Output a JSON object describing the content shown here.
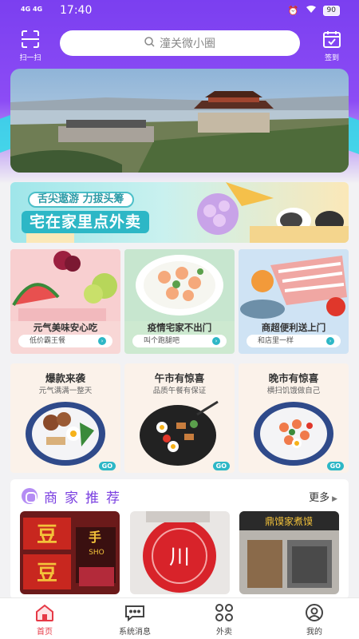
{
  "status_bar": {
    "network": [
      "4G",
      "4G"
    ],
    "time": "17:40",
    "battery": "90"
  },
  "header": {
    "scan_label": "扫一扫",
    "search_placeholder": "潼关微小圈",
    "checkin_label": "签到",
    "icons": {
      "scan": "scan-icon",
      "search": "search-icon",
      "checkin": "calendar-check-icon"
    }
  },
  "promo": {
    "slogan": "舌尖遨游 力拔头筹",
    "title": "宅在家里点外卖"
  },
  "categories": [
    {
      "title": "元气美味安心吃",
      "tag": "低价霸王餐"
    },
    {
      "title": "疫情宅家不出门",
      "tag": "叫个跑腿吧"
    },
    {
      "title": "商超便利送上门",
      "tag": "和店里一样"
    }
  ],
  "meals": [
    {
      "title": "爆款来袭",
      "subtitle": "元气满满一整天",
      "go": "GO"
    },
    {
      "title": "午市有惊喜",
      "subtitle": "品质午餐有保证",
      "go": "GO"
    },
    {
      "title": "晚市有惊喜",
      "subtitle": "横扫饥饿做自己",
      "go": "GO"
    }
  ],
  "recommend": {
    "title": "商家推荐",
    "more": "更多",
    "shop_signs": [
      "豆",
      "豆",
      "手",
      "SHO",
      "川",
      "鼎馍家煮馍"
    ]
  },
  "tabbar": [
    {
      "label": "首页",
      "icon": "home-icon",
      "active": true
    },
    {
      "label": "系统消息",
      "icon": "message-icon",
      "active": false
    },
    {
      "label": "外卖",
      "icon": "grid-icon",
      "active": false
    },
    {
      "label": "我的",
      "icon": "user-icon",
      "active": false
    }
  ],
  "colors": {
    "brand_purple": "#7b3ff0",
    "accent_cyan": "#2db7c6",
    "active_tab": "#e63946"
  }
}
